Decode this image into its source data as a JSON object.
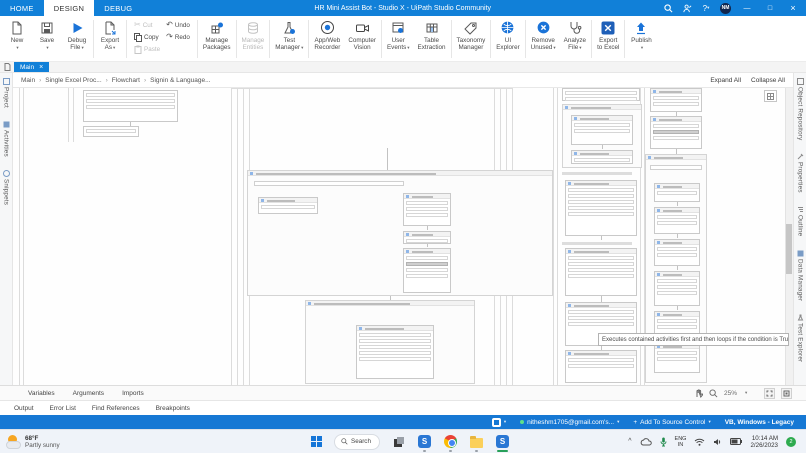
{
  "titlebar": {
    "tabs": [
      {
        "label": "HOME"
      },
      {
        "label": "DESIGN"
      },
      {
        "label": "DEBUG"
      }
    ],
    "title": "HR Mini Assist Bot - Studio X - UiPath Studio Community",
    "help": "?",
    "avatar": "NM",
    "minimize": "—",
    "maximize": "□",
    "close": "×"
  },
  "ribbon": {
    "buttons": [
      {
        "l1": "New",
        "l2": ""
      },
      {
        "l1": "Save",
        "l2": ""
      },
      {
        "l1": "Debug",
        "l2": "File"
      },
      {
        "l1": "Export",
        "l2": "As"
      },
      {
        "l1": "Manage",
        "l2": "Packages"
      },
      {
        "l1": "Manage",
        "l2": "Entities"
      },
      {
        "l1": "Test",
        "l2": "Manager"
      },
      {
        "l1": "App/Web",
        "l2": "Recorder"
      },
      {
        "l1": "Computer",
        "l2": "Vision"
      },
      {
        "l1": "User",
        "l2": "Events"
      },
      {
        "l1": "Table",
        "l2": "Extraction"
      },
      {
        "l1": "Taxonomy",
        "l2": "Manager"
      },
      {
        "l1": "UI",
        "l2": "Explorer"
      },
      {
        "l1": "Remove",
        "l2": "Unused"
      },
      {
        "l1": "Analyze",
        "l2": "File"
      },
      {
        "l1": "Export",
        "l2": "to Excel"
      },
      {
        "l1": "Publish",
        "l2": ""
      }
    ],
    "clipboard": {
      "cut": "Cut",
      "copy": "Copy",
      "paste": "Paste",
      "undo": "Undo",
      "redo": "Redo"
    }
  },
  "doc_tab": {
    "label": "Main"
  },
  "breadcrumb": {
    "items": [
      "Main",
      "Single Excel Proc...",
      "Flowchart",
      "Signin & Language..."
    ],
    "expand_all": "Expand All",
    "collapse_all": "Collapse All"
  },
  "left_rail": {
    "items": [
      "Project",
      "Activities",
      "Snippets"
    ]
  },
  "right_rail": {
    "items": [
      "Object Repository",
      "Properties",
      "Outline",
      "Data Manager",
      "Test Explorer"
    ]
  },
  "canvas": {
    "tooltip": "Executes contained activities first and then loops if the condition is True"
  },
  "bottom_panels": {
    "row1": [
      "Variables",
      "Arguments",
      "Imports"
    ],
    "row2": [
      "Output",
      "Error List",
      "Find References",
      "Breakpoints"
    ],
    "zoom": "25%"
  },
  "statusbar": {
    "account": "nitheshm1705@gmail.com's...",
    "add_source_control": "Add To Source Control",
    "compat": "VB, Windows - Legacy",
    "plus": "+"
  },
  "taskbar": {
    "temp": "68°F",
    "weather": "Partly sunny",
    "search": "Search",
    "studio_letter": "S",
    "lang1": "ENG",
    "lang2": "IN",
    "time": "10:14 AM",
    "date": "2/26/2023",
    "badge": "2",
    "chevron_up": "^"
  }
}
